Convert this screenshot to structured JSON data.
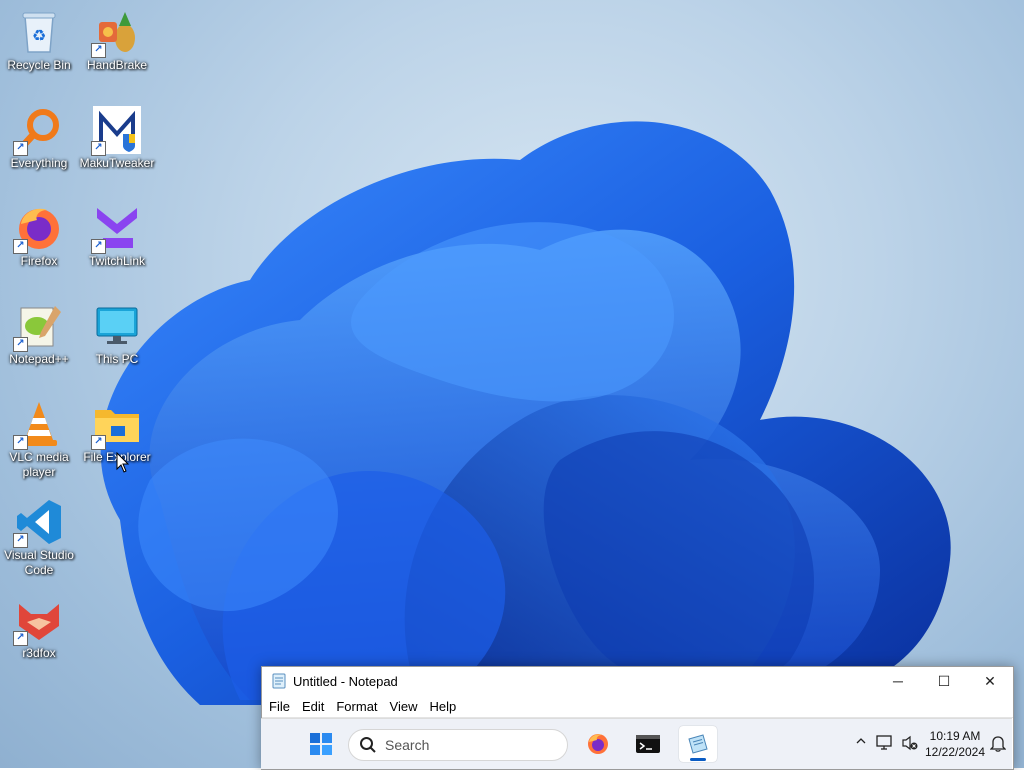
{
  "desktop": {
    "icons": [
      {
        "label": "Recycle Bin",
        "icon": "recycle-bin-icon"
      },
      {
        "label": "HandBrake",
        "icon": "handbrake-icon"
      },
      {
        "label": "Everything",
        "icon": "everything-icon"
      },
      {
        "label": "MakuTweaker",
        "icon": "makutweaker-icon"
      },
      {
        "label": "Firefox",
        "icon": "firefox-icon"
      },
      {
        "label": "TwitchLink",
        "icon": "twitchlink-icon"
      },
      {
        "label": "Notepad++",
        "icon": "notepadpp-icon"
      },
      {
        "label": "This PC",
        "icon": "this-pc-icon"
      },
      {
        "label": "VLC media player",
        "icon": "vlc-icon"
      },
      {
        "label": "File Explorer",
        "icon": "file-explorer-icon"
      },
      {
        "label": "Visual Studio Code",
        "icon": "vscode-icon"
      },
      {
        "label": "r3dfox",
        "icon": "r3dfox-icon"
      }
    ],
    "wallpaper_accent": "#1a5fe0"
  },
  "notepad": {
    "title": "Untitled - Notepad",
    "menu": [
      "File",
      "Edit",
      "Format",
      "View",
      "Help"
    ],
    "content": "",
    "minimize": "─",
    "maximize": "☐",
    "close": "✕"
  },
  "taskbar": {
    "search_placeholder": "Search",
    "apps": [
      "firefox-icon",
      "terminal-icon",
      "notepad-icon"
    ],
    "active_app": "notepad-icon",
    "tray": {
      "chevron": "^",
      "time": "10:19 AM",
      "date": "12/22/2024"
    }
  }
}
